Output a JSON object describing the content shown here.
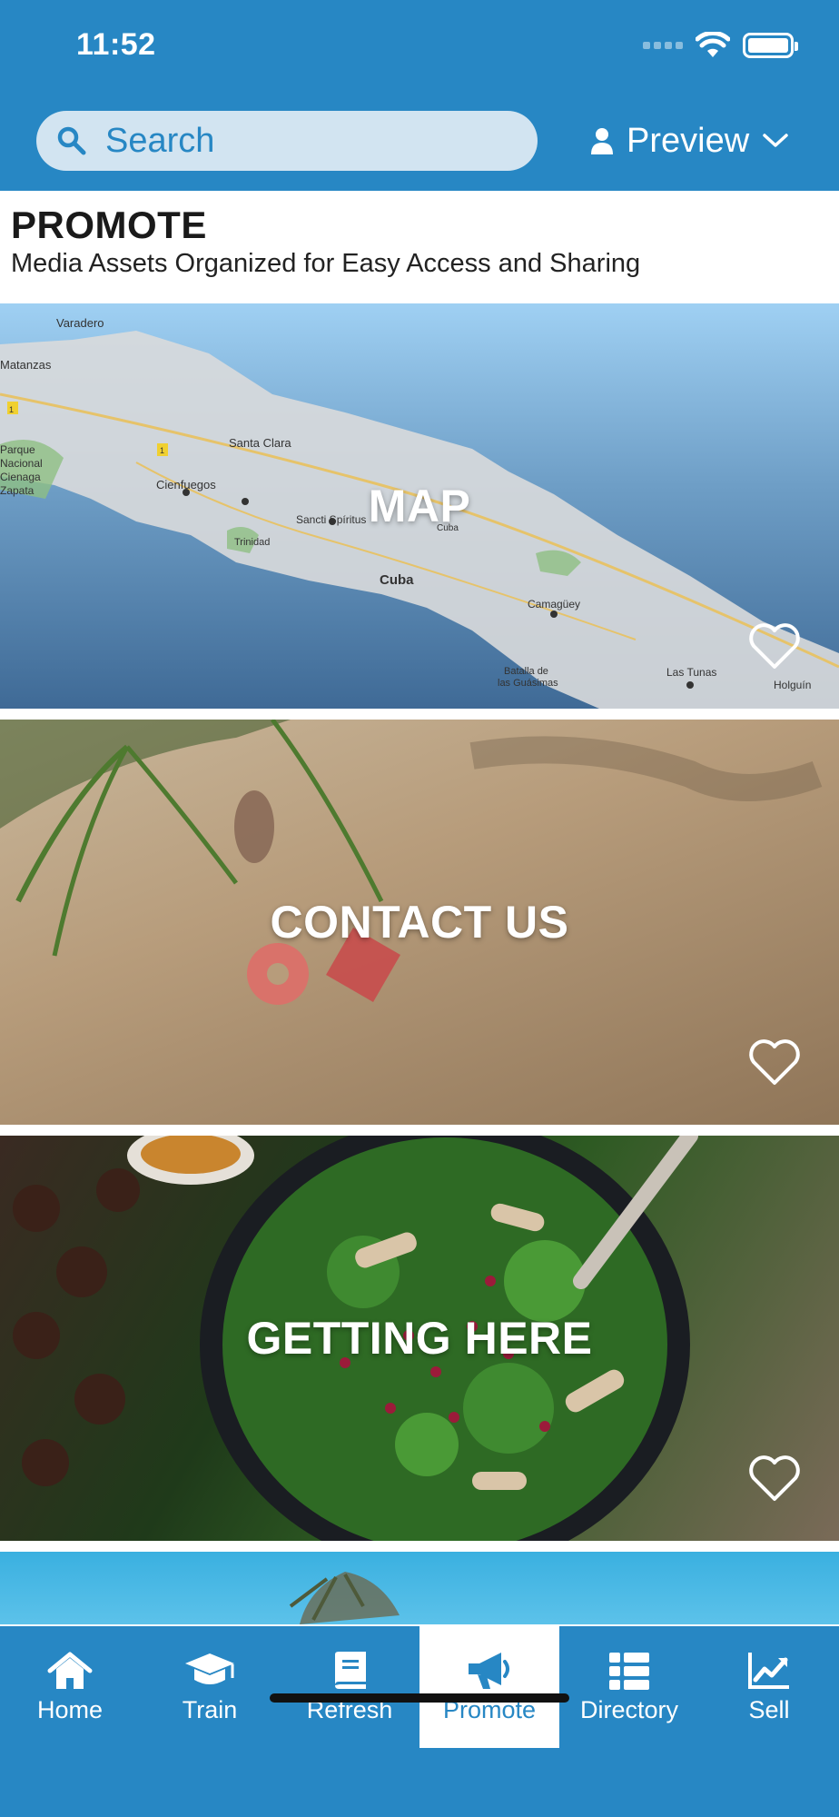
{
  "status_bar": {
    "time": "11:52"
  },
  "search": {
    "placeholder": "Search"
  },
  "preview": {
    "label": "Preview"
  },
  "header": {
    "title": "PROMOTE",
    "subtitle": "Media Assets Organized for Easy Access and Sharing"
  },
  "cards": [
    {
      "title": "MAP"
    },
    {
      "title": "CONTACT US"
    },
    {
      "title": "GETTING HERE"
    }
  ],
  "map_labels": {
    "varadero": "Varadero",
    "matanzas": "Matanzas",
    "santa_clara": "Santa Clara",
    "cienfuegos": "Cienfuegos",
    "parque": "Parque",
    "nacional": "Nacional",
    "cienaga": "Cienaga",
    "zapata": "Zapata",
    "sancti_spiritus": "Sancti Spíritus",
    "trinidad": "Trinidad",
    "cuba_small": "Cuba",
    "cuba": "Cuba",
    "camaguey": "Camagüey",
    "batalla": "Batalla de",
    "guasimas": "las Guásimas",
    "las_tunas": "Las Tunas",
    "holguin": "Holguín",
    "route_1a": "1",
    "route_1b": "1"
  },
  "nav": {
    "items": [
      {
        "label": "Home",
        "icon": "home-icon"
      },
      {
        "label": "Train",
        "icon": "graduation-cap-icon"
      },
      {
        "label": "Refresh",
        "icon": "book-icon"
      },
      {
        "label": "Promote",
        "icon": "megaphone-icon"
      },
      {
        "label": "Directory",
        "icon": "list-icon"
      },
      {
        "label": "Sell",
        "icon": "chart-icon"
      }
    ],
    "active": "Promote"
  },
  "colors": {
    "brand_blue": "#2787c4",
    "search_bg": "#d2e4f1",
    "active_tab_bg": "#ffffff"
  }
}
